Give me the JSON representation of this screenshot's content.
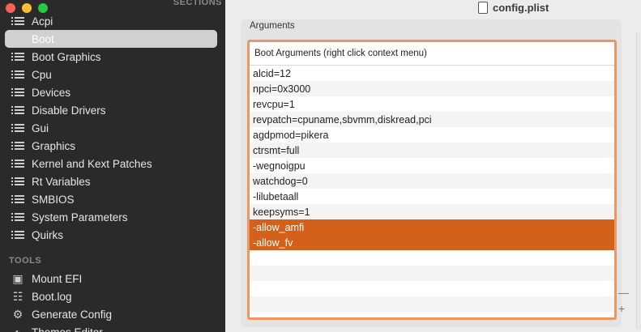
{
  "window": {
    "title": "config.plist"
  },
  "sidebar": {
    "sections_header": "SECTIONS",
    "items": [
      {
        "label": "Acpi"
      },
      {
        "label": "Boot",
        "selected": true
      },
      {
        "label": "Boot Graphics"
      },
      {
        "label": "Cpu"
      },
      {
        "label": "Devices"
      },
      {
        "label": "Disable Drivers"
      },
      {
        "label": "Gui"
      },
      {
        "label": "Graphics"
      },
      {
        "label": "Kernel and Kext Patches"
      },
      {
        "label": "Rt Variables"
      },
      {
        "label": "SMBIOS"
      },
      {
        "label": "System Parameters"
      },
      {
        "label": "Quirks"
      }
    ],
    "tools_header": "TOOLS",
    "tools": [
      {
        "label": "Mount EFI",
        "icon": "disk-icon"
      },
      {
        "label": "Boot.log",
        "icon": "log-icon"
      },
      {
        "label": "Generate Config",
        "icon": "gears-icon"
      },
      {
        "label": "Themes Editor",
        "icon": "palette-icon"
      }
    ]
  },
  "main": {
    "group_label": "Arguments",
    "table": {
      "header": "Boot Arguments (right click context menu)",
      "rows": [
        {
          "value": "alcid=12",
          "selected": false
        },
        {
          "value": "npci=0x3000",
          "selected": false
        },
        {
          "value": "revcpu=1",
          "selected": false
        },
        {
          "value": "revpatch=cpuname,sbvmm,diskread,pci",
          "selected": false
        },
        {
          "value": "agdpmod=pikera",
          "selected": false
        },
        {
          "value": "ctrsmt=full",
          "selected": false
        },
        {
          "value": "-wegnoigpu",
          "selected": false
        },
        {
          "value": "watchdog=0",
          "selected": false
        },
        {
          "value": "-lilubetaall",
          "selected": false
        },
        {
          "value": "keepsyms=1",
          "selected": false
        },
        {
          "value": "-allow_amfi",
          "selected": true
        },
        {
          "value": "-allow_fv",
          "selected": true
        }
      ]
    },
    "remove_label": "—",
    "add_label": "+"
  },
  "colors": {
    "selection": "#d3611c",
    "focus_ring": "#ec9565",
    "sidebar_bg": "#2a2a2a",
    "close": "#fe5f57",
    "minimize": "#febc2e",
    "zoom": "#28c840"
  }
}
